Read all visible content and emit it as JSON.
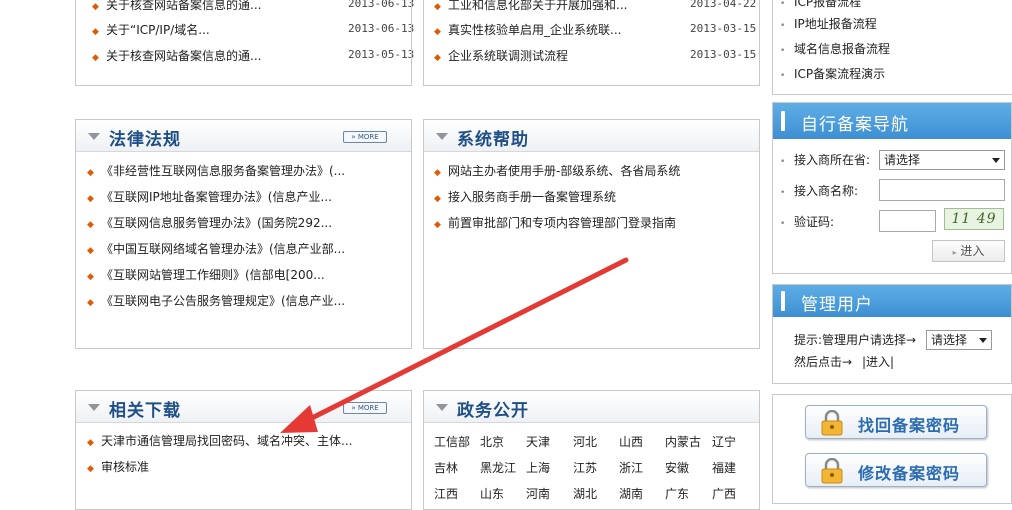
{
  "top_left_list": [
    {
      "text": "关于核查网站备案信息的通...",
      "date": "2013-06-13"
    },
    {
      "text": "关于“ICP/IP/域名...",
      "date": "2013-06-13"
    },
    {
      "text": "关于核查网站备案信息的通...",
      "date": "2013-05-13"
    }
  ],
  "top_right_list": [
    {
      "text": "工业和信息化部关于开展加强和...",
      "date": "2013-04-22"
    },
    {
      "text": "真实性核验单启用_企业系统联...",
      "date": "2013-03-15"
    },
    {
      "text": "企业系统联调测试流程",
      "date": "2013-03-15"
    }
  ],
  "side_top_links": [
    "ICP报备流程",
    "IP地址报备流程",
    "域名信息报备流程",
    "ICP备案流程演示"
  ],
  "law_panel": {
    "title": "法律法规",
    "more": "MORE",
    "items": [
      "《非经营性互联网信息服务备案管理办法》(...",
      "《互联网IP地址备案管理办法》(信息产业...",
      "《互联网信息服务管理办法》(国务院292...",
      "《中国互联网络域名管理办法》(信息产业部...",
      "《互联网站管理工作细则》(信部电[200...",
      "《互联网电子公告服务管理规定》(信息产业..."
    ]
  },
  "help_panel": {
    "title": "系统帮助",
    "items": [
      "网站主办者使用手册-部级系统、各省局系统",
      "接入服务商手册一备案管理系统",
      "前置审批部门和专项内容管理部门登录指南"
    ]
  },
  "download_panel": {
    "title": "相关下载",
    "more": "MORE",
    "items": [
      "天津市通信管理局找回密码、域名冲突、主体...",
      "审核标准"
    ]
  },
  "gov_panel": {
    "title": "政务公开",
    "rows": [
      [
        "工信部",
        "北京",
        "天津",
        "河北",
        "山西",
        "内蒙古",
        "辽宁"
      ],
      [
        "吉林",
        "黑龙江",
        "上海",
        "江苏",
        "浙江",
        "安徽",
        "福建"
      ],
      [
        "江西",
        "山东",
        "河南",
        "湖北",
        "湖南",
        "广东",
        "广西"
      ]
    ]
  },
  "self_nav": {
    "title": "自行备案导航",
    "province_label": "接入商所在省:",
    "province_value": "请选择",
    "name_label": "接入商名称:",
    "captcha_label": "验证码:",
    "captcha_text": "11 49",
    "enter_label": "进入"
  },
  "manage_user": {
    "title": "管理用户",
    "hint_label": "提示:管理用户请选择→",
    "select_value": "请选择",
    "then_label": "然后点击→",
    "enter_label": "|进入|"
  },
  "buttons": {
    "recover_password": "找回备案密码",
    "change_password": "修改备案密码"
  },
  "colors": {
    "panel_title": "#1f4f86",
    "side_header": "#3d8fd2",
    "bullet": "#e05a00",
    "arrow": "#e53935"
  }
}
